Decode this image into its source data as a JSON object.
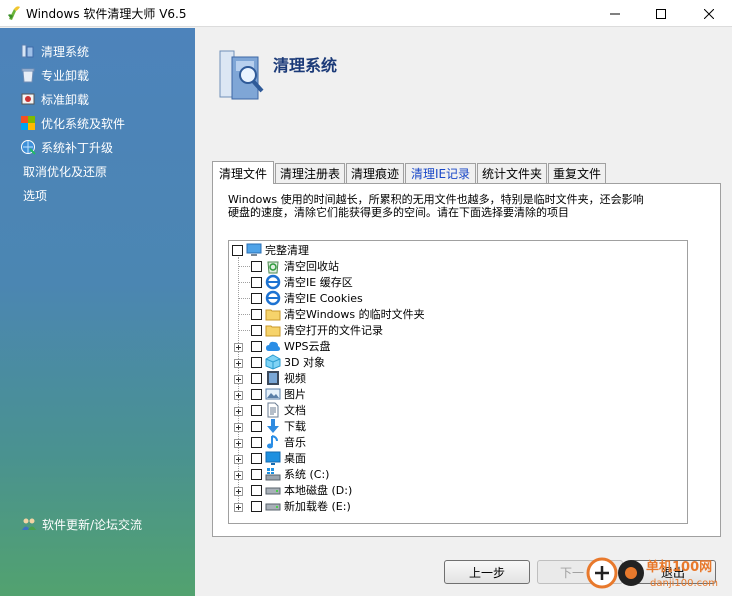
{
  "window": {
    "title": "Windows 软件清理大师 V6.5"
  },
  "sidebar": {
    "items": [
      {
        "label": "清理系统",
        "icon": "clean-system-icon"
      },
      {
        "label": "专业卸载",
        "icon": "pro-uninstall-icon"
      },
      {
        "label": "标准卸载",
        "icon": "standard-uninstall-icon"
      },
      {
        "label": "优化系统及软件",
        "icon": "optimize-icon"
      },
      {
        "label": "系统补丁升级",
        "icon": "patch-upgrade-icon"
      },
      {
        "label": "取消优化及还原"
      },
      {
        "label": "选项"
      }
    ],
    "bottom_link": "软件更新/论坛交流"
  },
  "header": {
    "title": "清理系统"
  },
  "tabs": [
    {
      "label": "清理文件",
      "active": true
    },
    {
      "label": "清理注册表"
    },
    {
      "label": "清理痕迹"
    },
    {
      "label": "清理IE记录"
    },
    {
      "label": "统计文件夹"
    },
    {
      "label": "重复文件"
    }
  ],
  "description": "Windows 使用的时间越长，所累积的无用文件也越多，特别是临时文件夹，还会影响硬盘的速度，清除它们能获得更多的空间。请在下面选择要清除的项目",
  "tree": {
    "root": "完整清理",
    "items": [
      {
        "label": "清空回收站",
        "icon": "recycle-bin-icon",
        "expandable": false
      },
      {
        "label": "清空IE 缓存区",
        "icon": "ie-icon",
        "expandable": false
      },
      {
        "label": "清空IE Cookies",
        "icon": "ie-icon",
        "expandable": false
      },
      {
        "label": "清空Windows 的临时文件夹",
        "icon": "folder-icon",
        "expandable": false
      },
      {
        "label": "清空打开的文件记录",
        "icon": "folder-icon",
        "expandable": false
      },
      {
        "label": "WPS云盘",
        "icon": "cloud-icon",
        "expandable": true
      },
      {
        "label": "3D 对象",
        "icon": "3d-objects-icon",
        "expandable": true
      },
      {
        "label": "视频",
        "icon": "video-icon",
        "expandable": true
      },
      {
        "label": "图片",
        "icon": "pictures-icon",
        "expandable": true
      },
      {
        "label": "文档",
        "icon": "document-icon",
        "expandable": true
      },
      {
        "label": "下载",
        "icon": "download-icon",
        "expandable": true
      },
      {
        "label": "音乐",
        "icon": "music-icon",
        "expandable": true
      },
      {
        "label": "桌面",
        "icon": "desktop-icon",
        "expandable": true
      },
      {
        "label": "系统 (C:)",
        "icon": "drive-c-icon",
        "expandable": true
      },
      {
        "label": "本地磁盘 (D:)",
        "icon": "drive-icon",
        "expandable": true
      },
      {
        "label": "新加载卷 (E:)",
        "icon": "drive-icon",
        "expandable": true
      }
    ]
  },
  "buttons": {
    "prev": "上一步",
    "next": "下一",
    "exit": "退出"
  },
  "watermark": {
    "line1": "单机100网",
    "line2": "danji100.com"
  },
  "colors": {
    "title_blue": "#1b3a78",
    "ie_tab_blue": "#1846c7",
    "sidebar_top": "#4d83bb",
    "sidebar_bottom": "#52a26f"
  }
}
